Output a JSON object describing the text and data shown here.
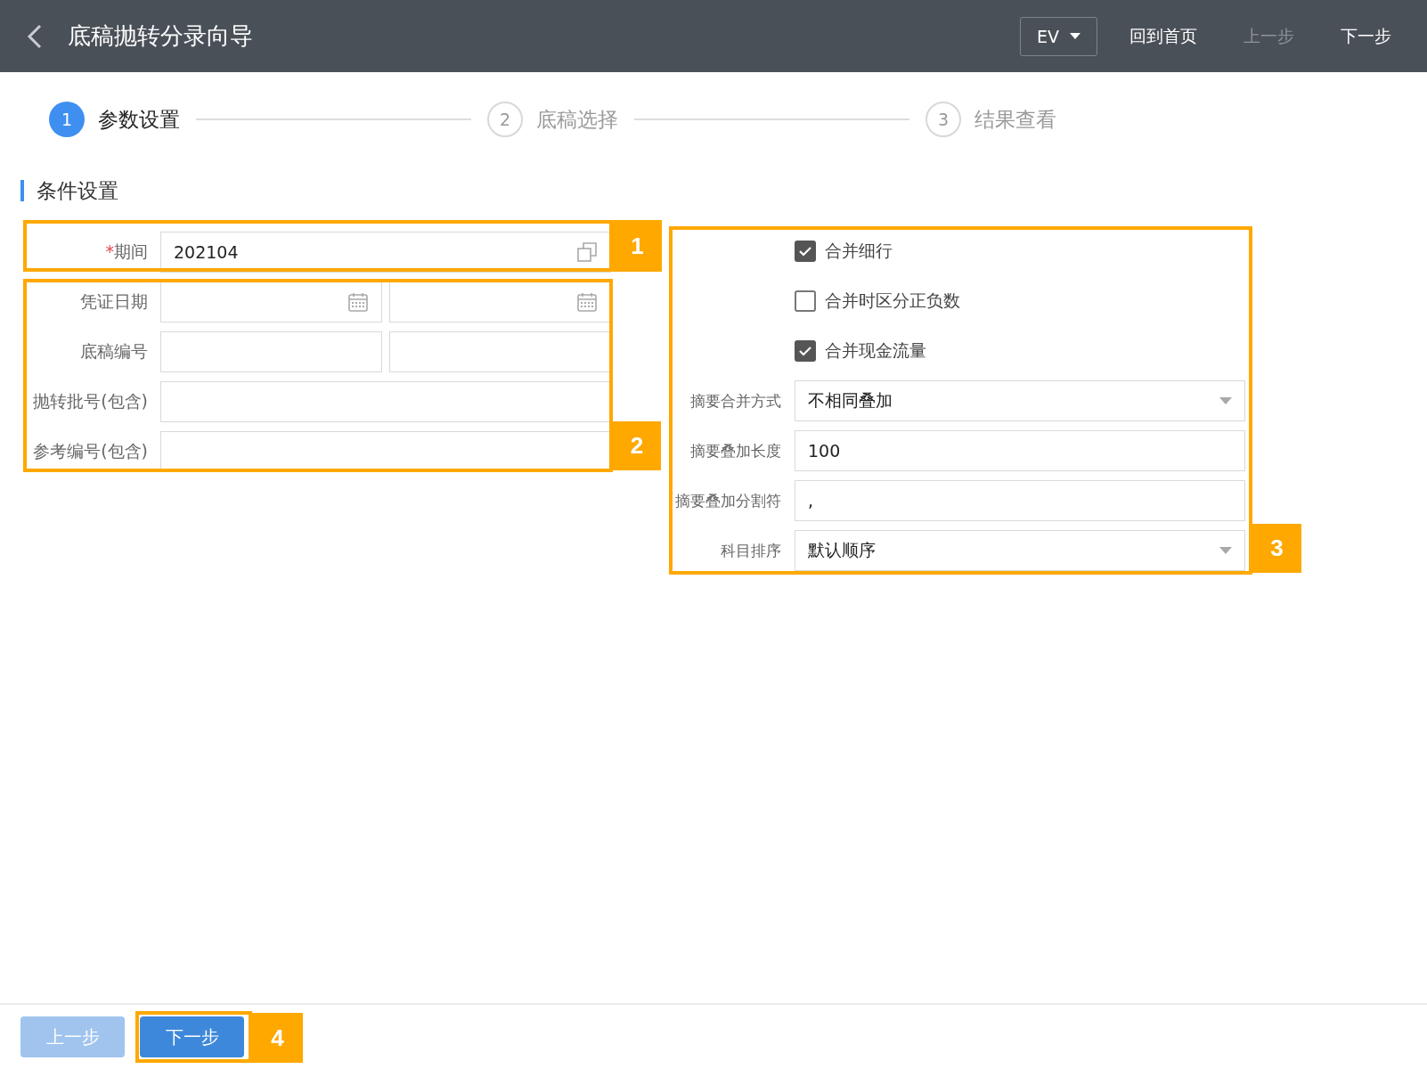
{
  "header": {
    "title": "底稿抛转分录向导",
    "env_select": {
      "value": "EV"
    },
    "links": [
      {
        "label": "回到首页",
        "disabled": false
      },
      {
        "label": "上一步",
        "disabled": true
      },
      {
        "label": "下一步",
        "disabled": false
      }
    ]
  },
  "steps": [
    {
      "number": "1",
      "label": "参数设置",
      "selected": true
    },
    {
      "number": "2",
      "label": "底稿选择",
      "selected": false
    },
    {
      "number": "3",
      "label": "结果查看",
      "selected": false
    }
  ],
  "section_title": "条件设置",
  "left_fields": [
    {
      "kind": "period",
      "label": "期间",
      "required_mark": "*",
      "value": "202104"
    },
    {
      "kind": "date_range",
      "label": "凭证日期"
    },
    {
      "kind": "text_range",
      "label": "底稿编号"
    },
    {
      "kind": "text",
      "label": "抛转批号(包含)"
    },
    {
      "kind": "text",
      "label": "参考编号(包含)"
    }
  ],
  "checkboxes": [
    {
      "label": "合并细行",
      "checked": true
    },
    {
      "label": "合并时区分正负数",
      "checked": false
    },
    {
      "label": "合并现金流量",
      "checked": true
    }
  ],
  "right_fields": [
    {
      "kind": "select",
      "label": "摘要合并方式",
      "value": "不相同叠加"
    },
    {
      "kind": "text",
      "label": "摘要叠加长度",
      "value": "100"
    },
    {
      "kind": "text",
      "label": "摘要叠加分割符",
      "value": ","
    },
    {
      "kind": "select",
      "label": "科目排序",
      "value": "默认顺序"
    }
  ],
  "footer_buttons": [
    {
      "label": "上一步",
      "disabled": true
    },
    {
      "label": "下一步",
      "disabled": false
    }
  ],
  "callouts": [
    {
      "label": "1"
    },
    {
      "label": "2"
    },
    {
      "label": "3"
    },
    {
      "label": "4"
    }
  ]
}
